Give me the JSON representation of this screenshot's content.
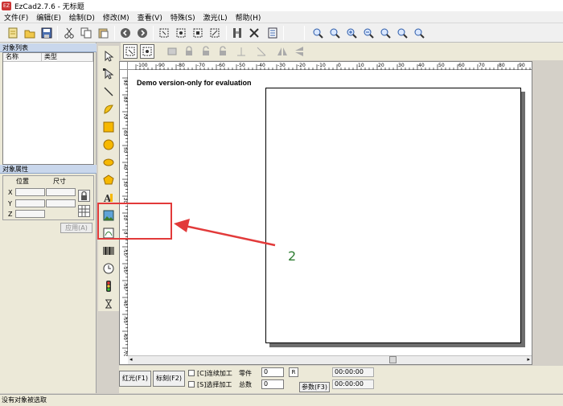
{
  "window": {
    "app_icon_text": "EZ",
    "title": "EzCad2.7.6 - 无标题"
  },
  "menubar": {
    "items": [
      "文件(F)",
      "编辑(E)",
      "绘制(D)",
      "修改(M)",
      "查看(V)",
      "特殊(S)",
      "激光(L)",
      "帮助(H)"
    ]
  },
  "toolbar": {
    "icons": [
      "new-file-icon",
      "open-file-icon",
      "save-icon",
      "cut-icon",
      "copy-icon",
      "paste-icon",
      "back-icon",
      "forward-icon",
      "select-all-icon",
      "select-center-icon",
      "select-node-icon",
      "select-invert-icon",
      "hatch-icon",
      "tools-icon",
      "list-icon",
      "zoom-in-icon",
      "zoom-icon",
      "zoom-plus-icon",
      "zoom-minus-icon",
      "zoom-fit-icon",
      "zoom-all-icon",
      "zoom-selected-icon"
    ]
  },
  "object_list": {
    "title": "对象列表",
    "col_name": "名称",
    "col_type": "类型"
  },
  "object_props": {
    "title": "对象属性",
    "position_label": "位置",
    "size_label": "尺寸",
    "x": "X",
    "y": "Y",
    "z": "Z",
    "apply_label": "应用(A)"
  },
  "ruler": {
    "h_labels": [
      "-100",
      "-90",
      "-80",
      "-70",
      "-60",
      "-50",
      "-40",
      "-30",
      "-20",
      "-10",
      "0",
      "10",
      "20",
      "30",
      "40",
      "50",
      "60",
      "70",
      "80",
      "90",
      "100"
    ],
    "v_labels": [
      "90",
      "80",
      "70",
      "60",
      "50",
      "40",
      "30",
      "20",
      "10",
      "0",
      "-10",
      "-20",
      "-30",
      "-40",
      "-50",
      "-60",
      "-70"
    ]
  },
  "canvas": {
    "demo_text": "Demo version-only for evaluation"
  },
  "bottom": {
    "red_light_label": "红光(F1)",
    "mark_label": "标刻(F2)",
    "continuous_label": "[C]连续加工",
    "selected_label": "[S]选择加工",
    "parts_label": "零件",
    "parts_value": "0",
    "reset_label": "R",
    "total_label": "总数",
    "total_value": "0",
    "params_label": "参数(F3)",
    "time1": "00:00:00",
    "time2": "00:00:00"
  },
  "status": {
    "text": "没有对象被选取"
  },
  "annotation": {
    "label": "2",
    "color": "#e23a3a"
  }
}
